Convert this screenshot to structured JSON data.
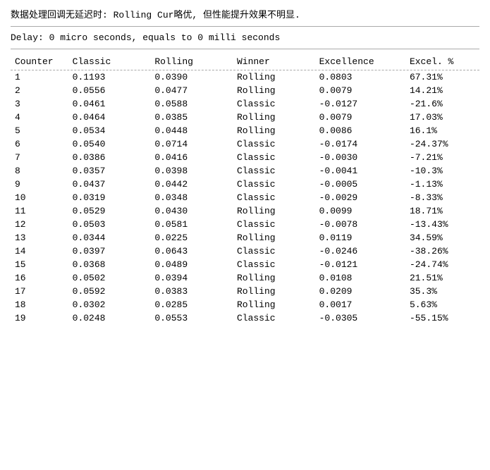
{
  "header": {
    "notice": "数据处理回调无延迟时: Rolling Cur略优, 但性能提升效果不明显."
  },
  "delay_line": "Delay: 0 micro seconds, equals to 0 milli seconds",
  "table": {
    "columns": [
      "Counter",
      "Classic",
      "Rolling",
      "Winner",
      "Excellence",
      "Excel. %"
    ],
    "rows": [
      {
        "counter": "1",
        "classic": "0.1193",
        "rolling": "0.0390",
        "winner": "Rolling",
        "excellence": "0.0803",
        "excel_pct": "67.31%"
      },
      {
        "counter": "2",
        "classic": "0.0556",
        "rolling": "0.0477",
        "winner": "Rolling",
        "excellence": "0.0079",
        "excel_pct": "14.21%"
      },
      {
        "counter": "3",
        "classic": "0.0461",
        "rolling": "0.0588",
        "winner": "Classic",
        "excellence": "-0.0127",
        "excel_pct": "-21.6%"
      },
      {
        "counter": "4",
        "classic": "0.0464",
        "rolling": "0.0385",
        "winner": "Rolling",
        "excellence": "0.0079",
        "excel_pct": "17.03%"
      },
      {
        "counter": "5",
        "classic": "0.0534",
        "rolling": "0.0448",
        "winner": "Rolling",
        "excellence": "0.0086",
        "excel_pct": "16.1%"
      },
      {
        "counter": "6",
        "classic": "0.0540",
        "rolling": "0.0714",
        "winner": "Classic",
        "excellence": "-0.0174",
        "excel_pct": "-24.37%"
      },
      {
        "counter": "7",
        "classic": "0.0386",
        "rolling": "0.0416",
        "winner": "Classic",
        "excellence": "-0.0030",
        "excel_pct": "-7.21%"
      },
      {
        "counter": "8",
        "classic": "0.0357",
        "rolling": "0.0398",
        "winner": "Classic",
        "excellence": "-0.0041",
        "excel_pct": "-10.3%"
      },
      {
        "counter": "9",
        "classic": "0.0437",
        "rolling": "0.0442",
        "winner": "Classic",
        "excellence": "-0.0005",
        "excel_pct": "-1.13%"
      },
      {
        "counter": "10",
        "classic": "0.0319",
        "rolling": "0.0348",
        "winner": "Classic",
        "excellence": "-0.0029",
        "excel_pct": "-8.33%"
      },
      {
        "counter": "11",
        "classic": "0.0529",
        "rolling": "0.0430",
        "winner": "Rolling",
        "excellence": "0.0099",
        "excel_pct": "18.71%"
      },
      {
        "counter": "12",
        "classic": "0.0503",
        "rolling": "0.0581",
        "winner": "Classic",
        "excellence": "-0.0078",
        "excel_pct": "-13.43%"
      },
      {
        "counter": "13",
        "classic": "0.0344",
        "rolling": "0.0225",
        "winner": "Rolling",
        "excellence": "0.0119",
        "excel_pct": "34.59%"
      },
      {
        "counter": "14",
        "classic": "0.0397",
        "rolling": "0.0643",
        "winner": "Classic",
        "excellence": "-0.0246",
        "excel_pct": "-38.26%"
      },
      {
        "counter": "15",
        "classic": "0.0368",
        "rolling": "0.0489",
        "winner": "Classic",
        "excellence": "-0.0121",
        "excel_pct": "-24.74%"
      },
      {
        "counter": "16",
        "classic": "0.0502",
        "rolling": "0.0394",
        "winner": "Rolling",
        "excellence": "0.0108",
        "excel_pct": "21.51%"
      },
      {
        "counter": "17",
        "classic": "0.0592",
        "rolling": "0.0383",
        "winner": "Rolling",
        "excellence": "0.0209",
        "excel_pct": "35.3%"
      },
      {
        "counter": "18",
        "classic": "0.0302",
        "rolling": "0.0285",
        "winner": "Rolling",
        "excellence": "0.0017",
        "excel_pct": "5.63%"
      },
      {
        "counter": "19",
        "classic": "0.0248",
        "rolling": "0.0553",
        "winner": "Classic",
        "excellence": "-0.0305",
        "excel_pct": "-55.15%"
      }
    ]
  }
}
